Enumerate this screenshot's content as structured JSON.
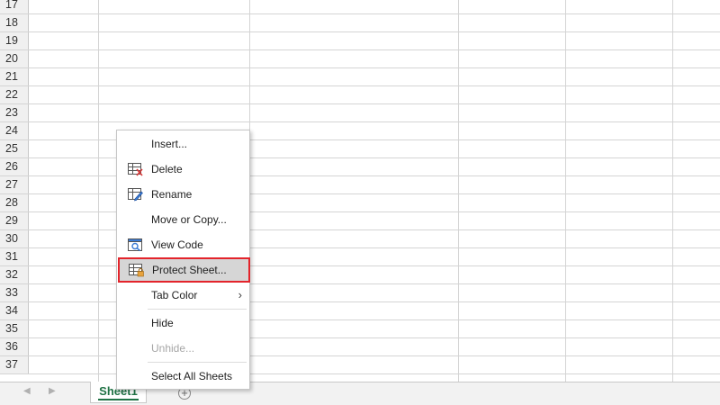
{
  "rows": [
    "17",
    "18",
    "19",
    "20",
    "21",
    "22",
    "23",
    "24",
    "25",
    "26",
    "27",
    "28",
    "29",
    "30",
    "31",
    "32",
    "33",
    "34",
    "35",
    "36",
    "37"
  ],
  "sheet_tabs": {
    "active_tab": "Sheet1",
    "prev_icon": "triangle-left",
    "next_icon": "triangle-right",
    "add_icon": "plus-circle"
  },
  "context_menu": {
    "items": [
      {
        "label": "Insert...",
        "icon": null
      },
      {
        "label": "Delete",
        "icon": "delete-sheet-icon"
      },
      {
        "label": "Rename",
        "icon": "rename-sheet-icon"
      },
      {
        "label": "Move or Copy...",
        "icon": null
      },
      {
        "label": "View Code",
        "icon": "view-code-icon"
      },
      {
        "label": "Protect Sheet...",
        "icon": "protect-sheet-icon",
        "highlighted": true
      },
      {
        "label": "Tab Color",
        "icon": null,
        "submenu": true
      },
      {
        "label": "Hide",
        "icon": null
      },
      {
        "label": "Unhide...",
        "icon": null,
        "disabled": true
      },
      {
        "label": "Select All Sheets",
        "icon": null
      }
    ]
  },
  "colors": {
    "accent_green": "#217346",
    "highlight_border": "#e3242b",
    "highlight_fill": "#d6d6d6"
  }
}
